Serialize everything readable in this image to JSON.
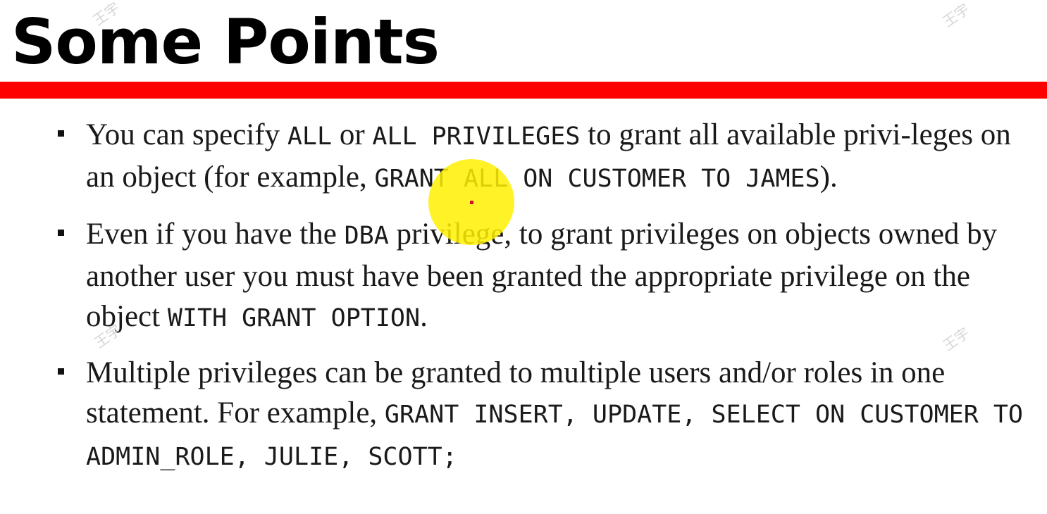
{
  "slide": {
    "title": "Some Points",
    "accent_color": "#ff0000",
    "highlight_color": "#fff000"
  },
  "bullets": [
    {
      "segments": [
        {
          "text": "You can specify ",
          "code": false
        },
        {
          "text": "ALL",
          "code": true
        },
        {
          "text": " or ",
          "code": false
        },
        {
          "text": "ALL PRIVILEGES",
          "code": true
        },
        {
          "text": " to grant all available privi-leges on an object (for example, ",
          "code": false
        },
        {
          "text": "GRANT ALL ON CUSTOMER TO JAMES",
          "code": true
        },
        {
          "text": ").",
          "code": false
        }
      ]
    },
    {
      "segments": [
        {
          "text": "Even if you have the ",
          "code": false
        },
        {
          "text": "DBA",
          "code": true
        },
        {
          "text": " privilege, to grant privileges on objects owned by another user you must have been granted the appropriate privilege on the object ",
          "code": false
        },
        {
          "text": "WITH GRANT OPTION",
          "code": true
        },
        {
          "text": ".",
          "code": false
        }
      ]
    },
    {
      "segments": [
        {
          "text": "Multiple privileges can be granted to multiple users and/or roles in one statement. For example, ",
          "code": false
        },
        {
          "text": "GRANT INSERT, UPDATE, SELECT ON CUSTOMER TO ADMIN_ROLE, JULIE, SCOTT;",
          "code": true
        }
      ]
    }
  ],
  "watermarks": [
    "王宇",
    "王宇",
    "王宇",
    "王宇"
  ]
}
